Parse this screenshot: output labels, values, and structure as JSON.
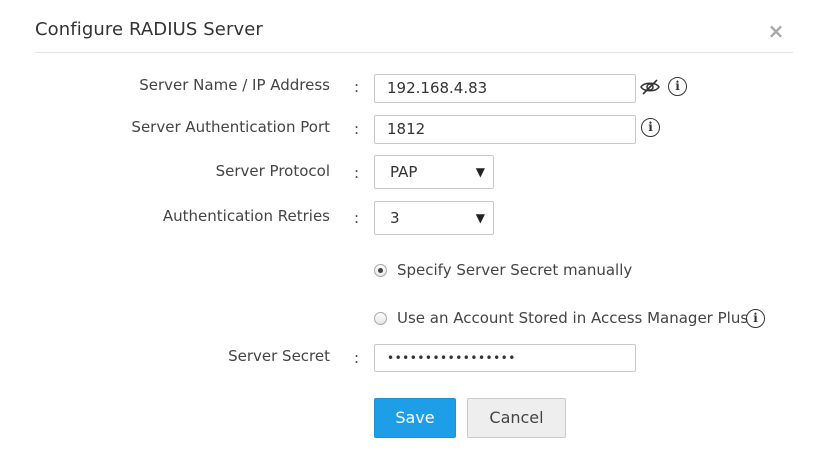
{
  "dialog": {
    "title": "Configure RADIUS Server",
    "close_glyph": "×"
  },
  "form": {
    "colon": ":",
    "server_name": {
      "label": "Server Name / IP Address",
      "value": "192.168.4.83",
      "icons": [
        "eye-slash-icon",
        "info-icon"
      ]
    },
    "auth_port": {
      "label": "Server Authentication Port",
      "value": "1812",
      "icons": [
        "info-icon"
      ]
    },
    "protocol": {
      "label": "Server Protocol",
      "selected": "PAP"
    },
    "retries": {
      "label": "Authentication Retries",
      "selected": "3"
    },
    "secret_mode": {
      "option_manual": "Specify Server Secret manually",
      "option_account": "Use an Account Stored in Access Manager Plus",
      "selected": "manual"
    },
    "server_secret": {
      "label": "Server Secret",
      "value": "•••••••••••••••••"
    }
  },
  "buttons": {
    "save": "Save",
    "cancel": "Cancel"
  },
  "colors": {
    "primary": "#1f9ee8",
    "border": "#c9c9c9",
    "text": "#333333"
  }
}
